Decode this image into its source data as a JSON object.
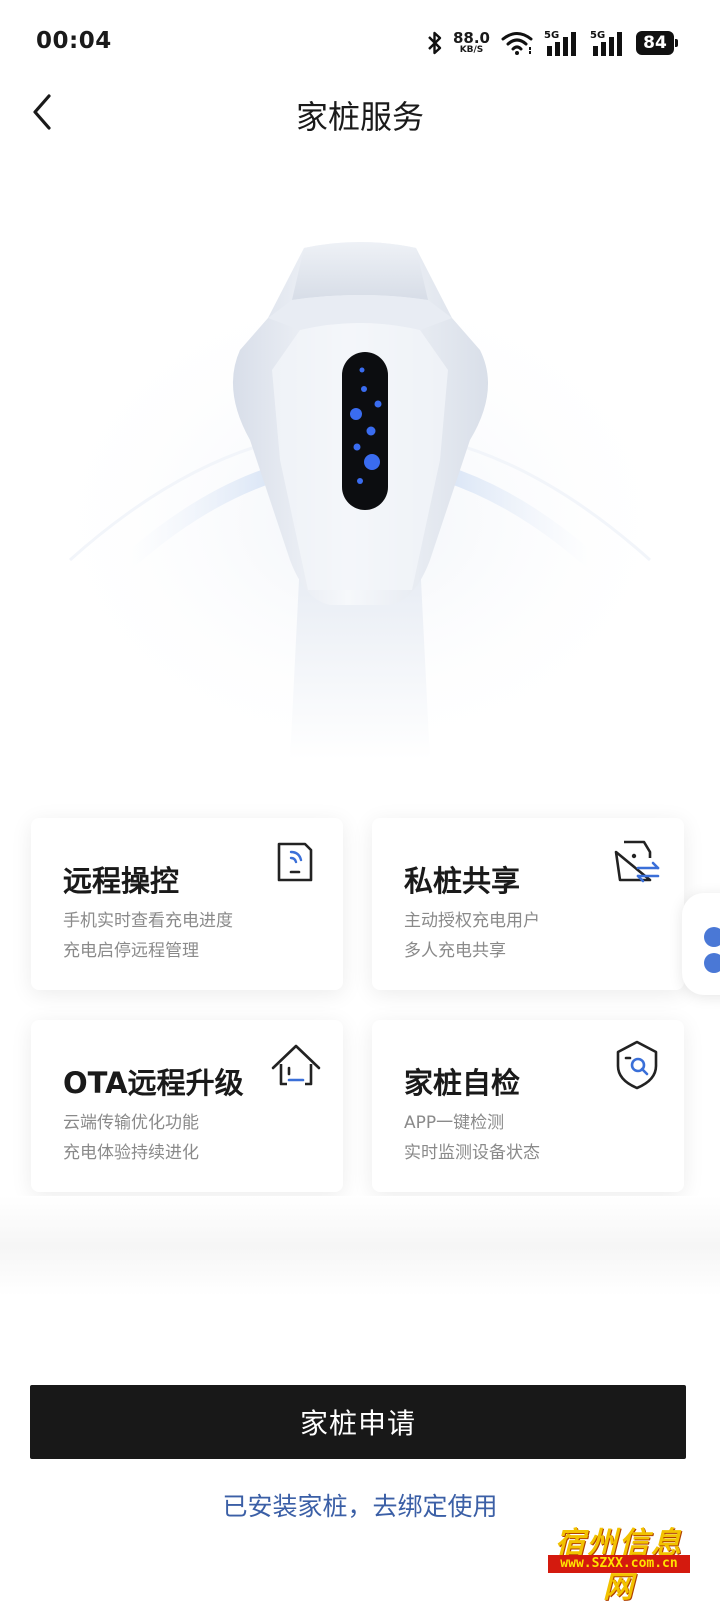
{
  "status_bar": {
    "time": "00:04",
    "net_speed_value": "88.0",
    "net_speed_unit": "KB/S",
    "signal_1_label": "5G",
    "signal_2_label": "5G",
    "battery": "84"
  },
  "header": {
    "title": "家桩服务",
    "back_icon": "chevron-left-icon"
  },
  "hero": {
    "image": "home-charger-illustration",
    "accent_color": "#3a6cf0"
  },
  "features": [
    {
      "title": "远程操控",
      "line1": "手机实时查看充电进度",
      "line2": "充电启停远程管理",
      "icon": "remote-signal-icon"
    },
    {
      "title": "私桩共享",
      "line1": "主动授权充电用户",
      "line2": "多人充电共享",
      "icon": "share-exchange-icon"
    },
    {
      "title": "OTA远程升级",
      "line1": "云端传输优化功能",
      "line2": "充电体验持续进化",
      "icon": "house-upgrade-icon"
    },
    {
      "title": "家桩自检",
      "line1": "APP一键检测",
      "line2": "实时监测设备状态",
      "icon": "shield-search-icon"
    }
  ],
  "actions": {
    "apply_label": "家桩申请",
    "bind_label": "已安装家桩，去绑定使用"
  },
  "watermark": {
    "text": "宿州信息网",
    "url": "www.SZXX.com.cn"
  },
  "colors": {
    "accent_blue": "#3b5fa6",
    "icon_blue": "#3a6fd8",
    "button_bg": "#181818"
  }
}
